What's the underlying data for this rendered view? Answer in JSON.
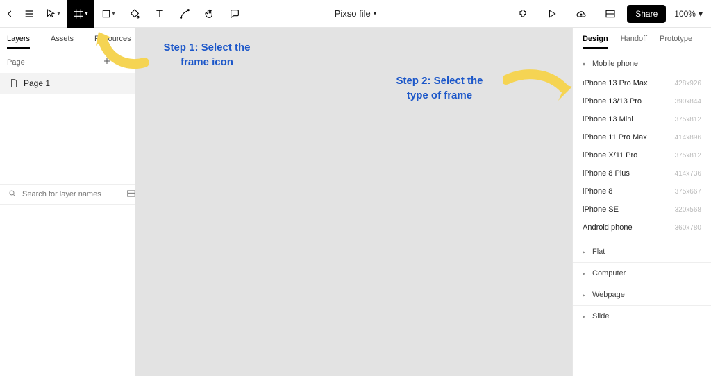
{
  "toolbar": {
    "file_title": "Pixso file",
    "share_label": "Share",
    "zoom": "100%"
  },
  "left_panel": {
    "tabs": {
      "layers": "Layers",
      "assets": "Assets",
      "resources": "Resources"
    },
    "page_label": "Page",
    "pages": [
      "Page 1"
    ],
    "search_placeholder": "Search for layer names"
  },
  "right_panel": {
    "tabs": {
      "design": "Design",
      "handoff": "Handoff",
      "prototype": "Prototype"
    },
    "sections": {
      "mobile": {
        "title": "Mobile phone",
        "presets": [
          {
            "name": "iPhone 13 Pro Max",
            "dim": "428x926"
          },
          {
            "name": "iPhone 13/13 Pro",
            "dim": "390x844"
          },
          {
            "name": "iPhone 13 Mini",
            "dim": "375x812"
          },
          {
            "name": "iPhone 11 Pro Max",
            "dim": "414x896"
          },
          {
            "name": "iPhone X/11 Pro",
            "dim": "375x812"
          },
          {
            "name": "iPhone 8 Plus",
            "dim": "414x736"
          },
          {
            "name": "iPhone 8",
            "dim": "375x667"
          },
          {
            "name": "iPhone SE",
            "dim": "320x568"
          },
          {
            "name": "Android phone",
            "dim": "360x780"
          }
        ]
      },
      "flat": {
        "title": "Flat"
      },
      "computer": {
        "title": "Computer"
      },
      "webpage": {
        "title": "Webpage"
      },
      "slide": {
        "title": "Slide"
      }
    }
  },
  "annotations": {
    "step1": "Step 1: Select  the frame icon",
    "step2": "Step 2: Select the type of frame"
  }
}
